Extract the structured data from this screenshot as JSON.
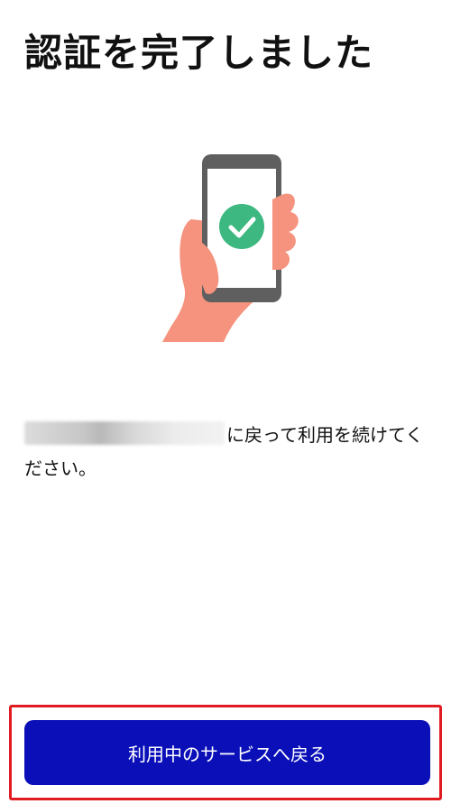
{
  "header": {
    "title": "認証を完了しました"
  },
  "illustration": {
    "icon": "phone-checkmark-icon",
    "colors": {
      "hand": "#F5937E",
      "phone_frame": "#5F5F5F",
      "check_circle": "#3DB880"
    }
  },
  "message": {
    "text_after_blur": "に戻って利用を続けてください。"
  },
  "actions": {
    "back_label": "利用中のサービスへ戻る",
    "button_color": "#0A0FB8",
    "highlight_color": "#E11B22"
  }
}
